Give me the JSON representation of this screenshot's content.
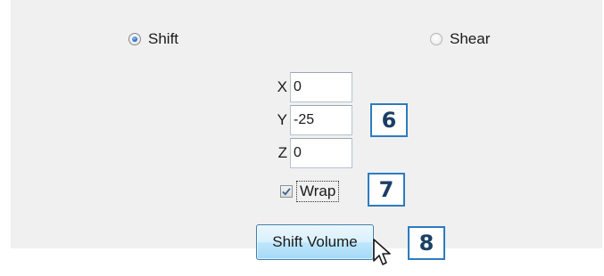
{
  "mode": {
    "shift_label": "Shift",
    "shift_selected": true,
    "shear_label": "Shear",
    "shear_selected": false
  },
  "offsets": {
    "x_label": "X",
    "x_value": "0",
    "y_label": "Y",
    "y_value": "-25",
    "z_label": "Z",
    "z_value": "0"
  },
  "wrap": {
    "label": "Wrap",
    "checked": true
  },
  "action": {
    "shift_volume_label": "Shift Volume"
  },
  "callouts": {
    "six": "6",
    "seven": "7",
    "eight": "8"
  },
  "colors": {
    "panel_bg": "#f0f0f0",
    "callout_border": "#2e7bbf",
    "callout_text": "#1b3f66",
    "button_border": "#3c7fb1"
  },
  "icons": {
    "cursor": "mouse-pointer-icon"
  }
}
